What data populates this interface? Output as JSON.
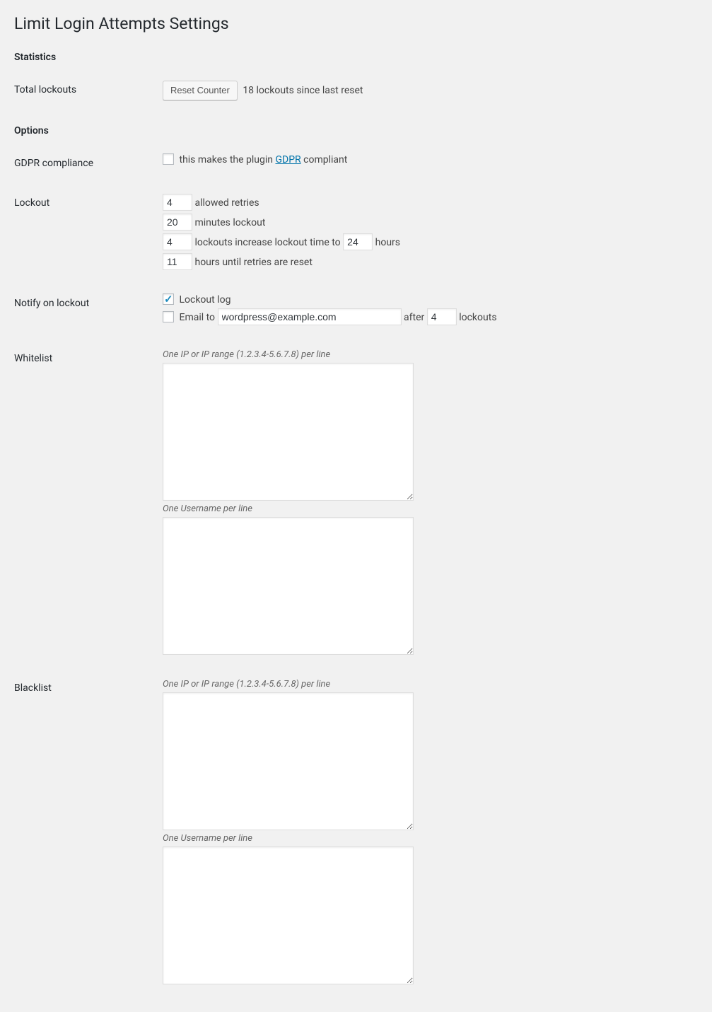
{
  "page": {
    "title": "Limit Login Attempts Settings"
  },
  "sections": {
    "statistics": "Statistics",
    "options": "Options"
  },
  "stats": {
    "label": "Total lockouts",
    "reset_button": "Reset Counter",
    "lockouts_text": "18 lockouts since last reset"
  },
  "gdpr": {
    "label": "GDPR compliance",
    "text_before": "this makes the plugin ",
    "link": "GDPR",
    "text_after": " compliant",
    "checked": false
  },
  "lockout": {
    "label": "Lockout",
    "allowed_retries": "4",
    "allowed_retries_text": "allowed retries",
    "minutes_lockout": "20",
    "minutes_lockout_text": "minutes lockout",
    "lockouts_increase": "4",
    "lockouts_increase_text_before": "lockouts increase lockout time to",
    "lockouts_increase_hours": "24",
    "lockouts_increase_text_after": "hours",
    "hours_reset": "11",
    "hours_reset_text": "hours until retries are reset"
  },
  "notify": {
    "label": "Notify on lockout",
    "log_checked": true,
    "log_text": "Lockout log",
    "email_checked": false,
    "email_text": "Email to",
    "email_value": "wordpress@example.com",
    "after_text": "after",
    "after_value": "4",
    "lockouts_text": "lockouts"
  },
  "whitelist": {
    "label": "Whitelist",
    "ip_hint": "One IP or IP range (1.2.3.4-5.6.7.8) per line",
    "user_hint": "One Username per line"
  },
  "blacklist": {
    "label": "Blacklist",
    "ip_hint": "One IP or IP range (1.2.3.4-5.6.7.8) per line",
    "user_hint": "One Username per line"
  }
}
